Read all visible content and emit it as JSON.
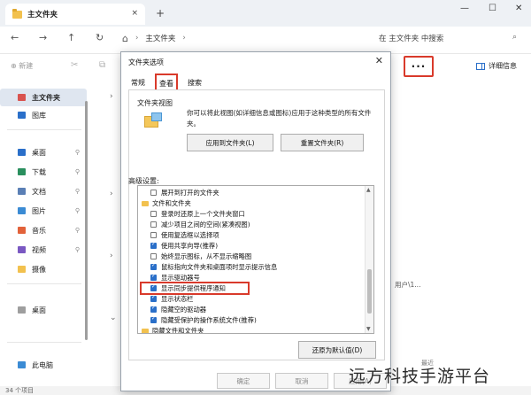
{
  "window": {
    "tab_title": "主文件夹",
    "tab_close": "×",
    "new_tab": "+",
    "controls": {
      "minimize": "—",
      "maximize": "☐",
      "close": "✕"
    }
  },
  "address": {
    "back": "←",
    "forward": "→",
    "up": "↑",
    "refresh": "↻",
    "home_icon": "⌂",
    "sep": "›",
    "path": "主文件夹",
    "path_sep": "›",
    "search_placeholder": "在 主文件夹 中搜索",
    "search_icon": "⌕"
  },
  "commandbar": {
    "new_label": "⊕ 新建",
    "more_label": "···",
    "details_label": "详细信息"
  },
  "sidebar": {
    "items": [
      {
        "label": "主文件夹",
        "icon": "home-icon",
        "color": "#d9534f",
        "pinned": false
      },
      {
        "label": "图库",
        "icon": "gallery-icon",
        "color": "#2a6fc9",
        "pinned": false
      },
      {
        "label": "桌面",
        "icon": "desktop-icon",
        "color": "#2a6fc9",
        "pinned": true
      },
      {
        "label": "下载",
        "icon": "download-icon",
        "color": "#2a8f5e",
        "pinned": true
      },
      {
        "label": "文档",
        "icon": "document-icon",
        "color": "#5a7fb5",
        "pinned": true
      },
      {
        "label": "图片",
        "icon": "pictures-icon",
        "color": "#3b8bd4",
        "pinned": true
      },
      {
        "label": "音乐",
        "icon": "music-icon",
        "color": "#e2623a",
        "pinned": true
      },
      {
        "label": "视频",
        "icon": "video-icon",
        "color": "#7a58c2",
        "pinned": true
      },
      {
        "label": "摄像",
        "icon": "camera-folder-icon",
        "color": "#f2c14e",
        "pinned": false
      },
      {
        "label": "桌面",
        "icon": "folder-icon",
        "color": "#9e9e9e",
        "pinned": false
      },
      {
        "label": "此电脑",
        "icon": "pc-icon",
        "color": "#3b8bd4",
        "pinned": false
      }
    ],
    "pin_glyph": "📌"
  },
  "content": {
    "user_text": "用户\\1...",
    "recent_fragment": "最近"
  },
  "status": {
    "count": "34 个项目"
  },
  "dialog": {
    "title": "文件夹选项",
    "close": "✕",
    "tabs": [
      "常规",
      "查看",
      "搜索"
    ],
    "active_tab": "查看",
    "view_group_title": "文件夹视图",
    "view_desc": "你可以将此视图(如详细信息或图标)应用于这种类型的所有文件夹。",
    "apply_button": "应用到文件夹(L)",
    "reset_button": "重置文件夹(R)",
    "advanced_label": "高级设置:",
    "tree": [
      {
        "type": "checkbox",
        "checked": false,
        "label": "展开到打开的文件夹"
      },
      {
        "type": "folder",
        "label": "文件和文件夹"
      },
      {
        "type": "checkbox",
        "checked": false,
        "label": "登录时还原上一个文件夹窗口"
      },
      {
        "type": "checkbox",
        "checked": false,
        "label": "减少项目之间的空间(紧凑视图)"
      },
      {
        "type": "checkbox",
        "checked": false,
        "label": "使用复选框以选择项"
      },
      {
        "type": "checkbox",
        "checked": true,
        "label": "使用共享向导(推荐)"
      },
      {
        "type": "checkbox",
        "checked": false,
        "label": "始终显示图标，从不显示缩略图"
      },
      {
        "type": "checkbox",
        "checked": true,
        "label": "鼠标指向文件夹和桌面项时显示提示信息"
      },
      {
        "type": "checkbox",
        "checked": true,
        "label": "显示驱动器号"
      },
      {
        "type": "checkbox",
        "checked": true,
        "label": "显示同步提供程序通知"
      },
      {
        "type": "checkbox",
        "checked": true,
        "label": "显示状态栏"
      },
      {
        "type": "checkbox",
        "checked": true,
        "label": "隐藏空的驱动器"
      },
      {
        "type": "checkbox",
        "checked": true,
        "label": "隐藏受保护的操作系统文件(推荐)"
      },
      {
        "type": "folder",
        "label": "隐藏文件和文件夹"
      }
    ],
    "restore_button": "还原为默认值(D)",
    "ok_button": "确定",
    "cancel_button": "取消",
    "apply_footer_button": "应用(A)"
  },
  "watermark": "远方科技手游平台",
  "colors": {
    "highlight_red": "#d93a2b",
    "accent_blue": "#2a6fc9",
    "folder_yellow": "#f2c14e"
  }
}
